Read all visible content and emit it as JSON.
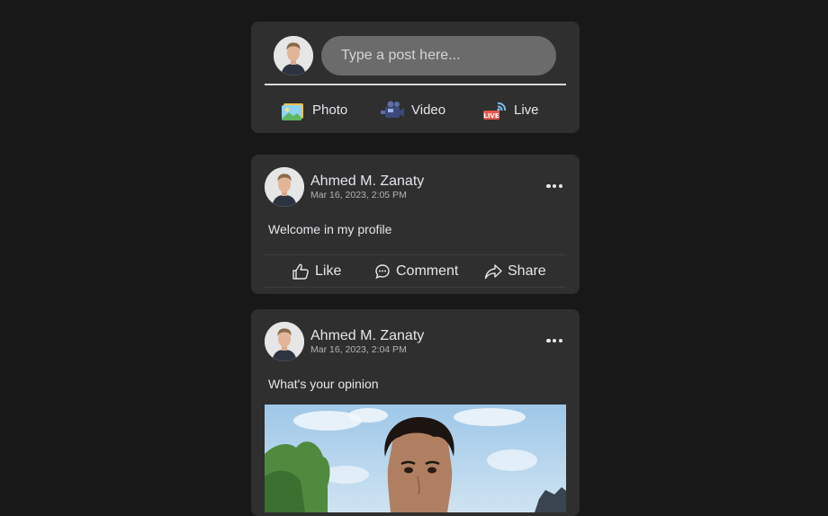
{
  "composer": {
    "placeholder": "Type a post here...",
    "actions": [
      {
        "label": "Photo",
        "icon": "photo-icon"
      },
      {
        "label": "Video",
        "icon": "video-camera-icon"
      },
      {
        "label": "Live",
        "icon": "live-icon"
      }
    ]
  },
  "posts": [
    {
      "author": "Ahmed M. Zanaty",
      "time": "Mar 16, 2023, 2:05 PM",
      "text": "Welcome in my profile",
      "actions": {
        "like": "Like",
        "comment": "Comment",
        "share": "Share"
      }
    },
    {
      "author": "Ahmed M. Zanaty",
      "time": "Mar 16, 2023, 2:04 PM",
      "text": "What's your opinion"
    }
  ],
  "colors": {
    "page_bg": "#181818",
    "card_bg": "#2f2f2f",
    "input_bg": "#6b6b6b",
    "text": "#e4e6eb",
    "muted": "#b0b3b8"
  }
}
